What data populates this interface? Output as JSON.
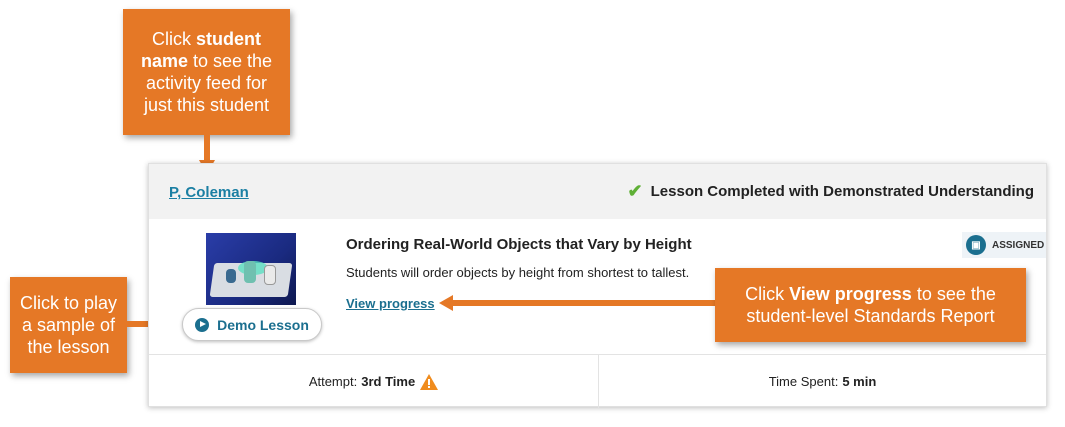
{
  "callouts": {
    "top": {
      "pre": "Click ",
      "bold": "student name",
      "post": " to see the activity feed for just this student"
    },
    "left": {
      "text": "Click to play a sample of the lesson"
    },
    "right": {
      "pre": "Click ",
      "bold": "View progress",
      "post": " to see the student-level Standards Report"
    }
  },
  "card": {
    "student_name": "P, Coleman",
    "status": "Lesson Completed with Demonstrated Understanding",
    "lesson_title": "Ordering Real-World Objects that Vary by Height",
    "lesson_description": "Students will order objects by height from shortest to tallest.",
    "view_progress_label": "View progress",
    "demo_button_label": "Demo Lesson",
    "badge_label": "ASSIGNED",
    "attempt_label": "Attempt:",
    "attempt_value": "3rd Time",
    "time_label": "Time Spent:",
    "time_value": "5 min"
  },
  "colors": {
    "callout": "#e57826",
    "link": "#1b7fa3",
    "check": "#5fb036",
    "warning": "#f08c1e"
  }
}
